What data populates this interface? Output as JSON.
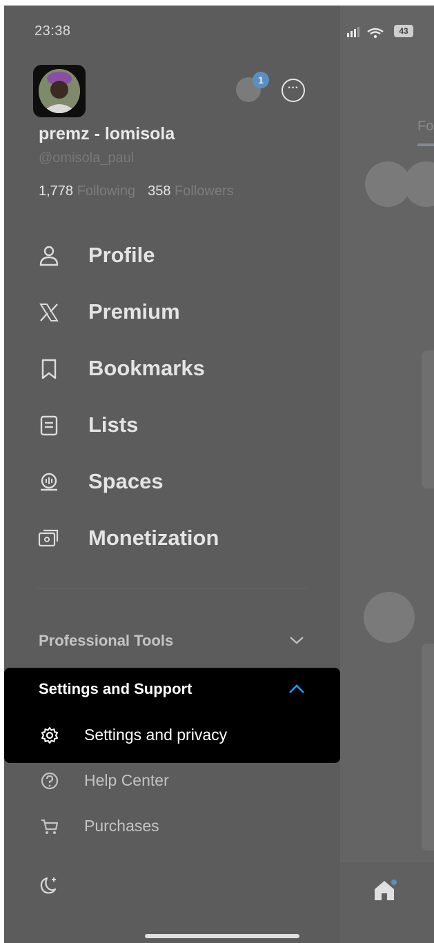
{
  "status_bar": {
    "time": "23:38",
    "battery": "43"
  },
  "account": {
    "display_name": "premz - lomisola",
    "handle": "@omisola_paul",
    "following_count": "1,778",
    "following_label": "Following",
    "followers_count": "358",
    "followers_label": "Followers",
    "notification_badge": "1"
  },
  "menu": {
    "items": [
      {
        "label": "Profile",
        "icon": "person-icon"
      },
      {
        "label": "Premium",
        "icon": "x-logo-icon"
      },
      {
        "label": "Bookmarks",
        "icon": "bookmark-icon"
      },
      {
        "label": "Lists",
        "icon": "list-icon"
      },
      {
        "label": "Spaces",
        "icon": "spaces-icon"
      },
      {
        "label": "Monetization",
        "icon": "monetization-icon"
      }
    ]
  },
  "sections": {
    "professional_tools": "Professional Tools",
    "settings_support": "Settings and Support",
    "settings_privacy": "Settings and privacy",
    "help_center": "Help Center",
    "purchases": "Purchases"
  },
  "feed": {
    "tab_label": "Fo"
  },
  "colors": {
    "accent": "#1d9bf0",
    "panel": "#000000",
    "overlay": "#5c5c5c"
  }
}
